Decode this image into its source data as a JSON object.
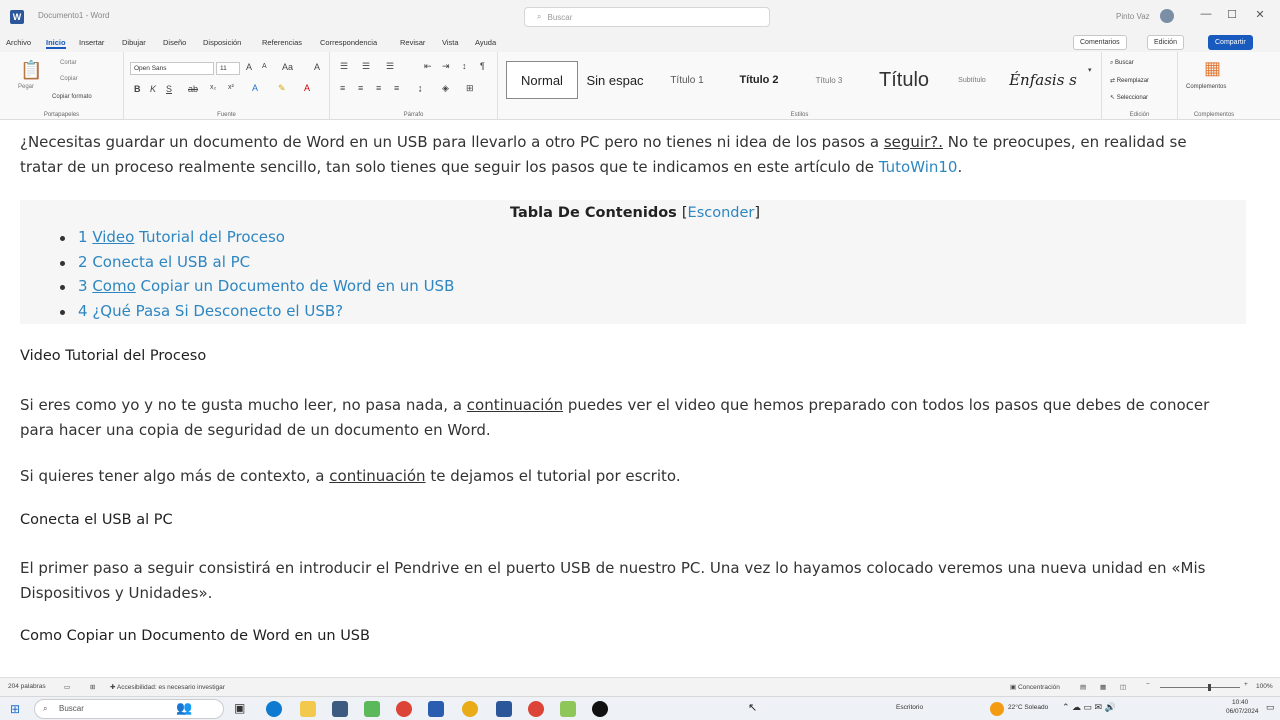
{
  "window": {
    "title": "Documento1 - Word",
    "search_placeholder": "Buscar",
    "user_name": "Pinto Vaz",
    "minimize": "—",
    "maximize": "☐",
    "close": "✕"
  },
  "menu": {
    "items": [
      "Archivo",
      "Inicio",
      "Insertar",
      "Dibujar",
      "Diseño",
      "Disposición",
      "Referencias",
      "Correspondencia",
      "Revisar",
      "Vista",
      "Ayuda"
    ],
    "active_index": 1,
    "comments_label": "Comentarios",
    "editing_label": "Edición",
    "share_label": "Compartir"
  },
  "ribbon": {
    "clipboard": {
      "paste": "Pegar",
      "cut": "Cortar",
      "copy": "Copiar",
      "format_painter": "Copiar formato",
      "label": "Portapapeles"
    },
    "font": {
      "family": "Open Sans",
      "size": "11",
      "label": "Fuente"
    },
    "paragraph": {
      "label": "Párrafo"
    },
    "styles": {
      "items": [
        "Normal",
        "Sin espac",
        "Título 1",
        "Título 2",
        "Título 3",
        "Título",
        "Subtítulo",
        "Énfasis s"
      ],
      "label": "Estilos"
    },
    "editing": {
      "find": "Buscar",
      "replace": "Reemplazar",
      "select": "Seleccionar",
      "label": "Edición"
    },
    "addins": {
      "button": "Complementos",
      "label": "Complementos"
    }
  },
  "document": {
    "intro": {
      "text_a": "¿Necesitas guardar un documento de Word en un USB para llevarlo a otro PC pero no tienes ni idea de los pasos a ",
      "text_b": "seguir?.",
      "text_c": " No te preocupes, en realidad se tratar de un proceso realmente sencillo, tan solo tienes que seguir los pasos que te indicamos en este artículo de ",
      "link": "TutoWin10",
      "text_d": "."
    },
    "toc": {
      "title": "Tabla De Contenidos",
      "toggle_open": "[",
      "toggle": "Esconder",
      "toggle_close": "]",
      "items": [
        {
          "num": "1 ",
          "u": "Video",
          "rest": " Tutorial del Proceso"
        },
        {
          "num": "2 ",
          "u": "",
          "rest": "Conecta el USB al PC"
        },
        {
          "num": "3 ",
          "u": "Como",
          "rest": " Copiar un Documento de Word en un USB"
        },
        {
          "num": "4 ",
          "u": "",
          "rest": "¿Qué Pasa Si Desconecto el USB?"
        }
      ]
    },
    "heading1": "Video Tutorial del Proceso",
    "para1": {
      "a": "Si eres como yo y no te gusta mucho leer, no pasa nada, a ",
      "u": "continuación",
      "b": " puedes ver el video que hemos preparado con todos los pasos que debes de conocer para hacer una copia de seguridad de un documento en Word."
    },
    "para2": {
      "a": "Si quieres tener algo más de contexto, a ",
      "u": "continuación",
      "b": " te dejamos el tutorial por escrito."
    },
    "heading2": "Conecta el USB al PC",
    "para3": "El primer paso a seguir consistirá en introducir el Pendrive en el puerto USB de nuestro PC. Una vez lo hayamos colocado veremos una nueva unidad en «Mis Dispositivos y Unidades».",
    "heading3": "Como Copiar un Documento de Word en un USB"
  },
  "statusbar": {
    "words": "204 palabras",
    "accessibility": "Accesibilidad: es necesario investigar",
    "focus": "Concentración",
    "zoom": "100%"
  },
  "taskbar": {
    "search": "Buscar",
    "tray_label": "Escritorio",
    "weather": "22°C  Soleado",
    "time": "10:40",
    "date": "06/07/2024"
  },
  "colors": {
    "accent": "#185abd",
    "link": "#2e86c1"
  }
}
